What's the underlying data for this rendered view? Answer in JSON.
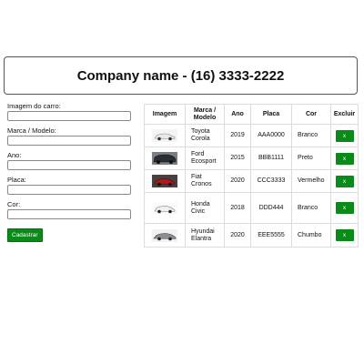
{
  "header": {
    "title": "Company name - (16) 3333-2222"
  },
  "form": {
    "fields": [
      {
        "label": "Imagem do carro:",
        "value": ""
      },
      {
        "label": "Marca / Modelo:",
        "value": ""
      },
      {
        "label": "Ano:",
        "value": ""
      },
      {
        "label": "Placa:",
        "value": ""
      },
      {
        "label": "Cor:",
        "value": ""
      }
    ],
    "submit_label": "Cadastrar"
  },
  "table": {
    "headers": [
      "Imagem",
      "Marca / Modelo",
      "Ano",
      "Placa",
      "Cor",
      "Excluir"
    ],
    "rows": [
      {
        "image": "car-image",
        "brand": "Toyota",
        "model": "Corola",
        "year": "2019",
        "plate": "AAA0000",
        "color": "Branco",
        "delete": "x"
      },
      {
        "image": "car-image",
        "brand": "Ford",
        "model": "Ecosport",
        "year": "2015",
        "plate": "BBB1111",
        "color": "Preto",
        "delete": "x"
      },
      {
        "image": "car-image",
        "brand": "Fiat",
        "model": "Cronos",
        "year": "2020",
        "plate": "CCC3333",
        "color": "Vermelho",
        "delete": "x"
      },
      {
        "image": "car-image",
        "brand": "Honda",
        "model": "Civic",
        "year": "2018",
        "plate": "DDD444",
        "color": "Branco",
        "delete": "x"
      },
      {
        "image": "car-image",
        "brand": "Hyundai",
        "model": "Elantra",
        "year": "2020",
        "plate": "EEE5555",
        "color": "Chumbo",
        "delete": "x"
      }
    ]
  },
  "colors": {
    "accent": "#0a8a18"
  }
}
